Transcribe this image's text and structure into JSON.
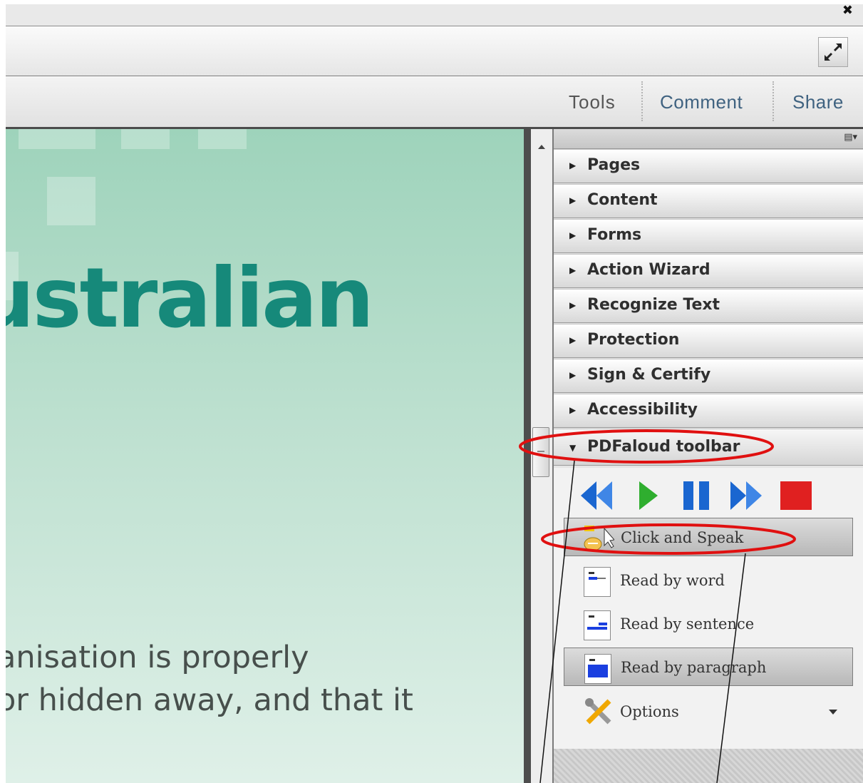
{
  "window": {
    "close_glyph": "✖"
  },
  "taskbar": {
    "tools": "Tools",
    "comment": "Comment",
    "share": "Share"
  },
  "document": {
    "title_fragment": "ustralian",
    "line1": "anisation is properly",
    "line2": "or hidden away, and that it"
  },
  "panels": [
    {
      "label": "Pages"
    },
    {
      "label": "Content"
    },
    {
      "label": "Forms"
    },
    {
      "label": "Action Wizard"
    },
    {
      "label": "Recognize Text"
    },
    {
      "label": "Protection"
    },
    {
      "label": "Sign & Certify"
    },
    {
      "label": "Accessibility"
    },
    {
      "label": "PDFaloud toolbar"
    }
  ],
  "pdfaloud": {
    "click_and_speak": "Click and Speak",
    "read_by_word": "Read by word",
    "read_by_sentence": "Read by sentence",
    "read_by_paragraph": "Read by paragraph",
    "options": "Options"
  },
  "colors": {
    "accent_text": "#3f6280",
    "doc_title": "#16897a",
    "annotation": "#e01010",
    "play_green": "#2fae2f",
    "media_blue": "#1a66d0",
    "stop_red": "#e02020"
  },
  "icons": [
    "close-icon",
    "fullscreen-icon",
    "panel-options-icon",
    "scroll-up-icon",
    "rewind-icon",
    "play-icon",
    "pause-icon",
    "fast-forward-icon",
    "stop-icon",
    "click-speak-icon",
    "read-word-icon",
    "read-sentence-icon",
    "read-paragraph-icon",
    "options-icon"
  ]
}
